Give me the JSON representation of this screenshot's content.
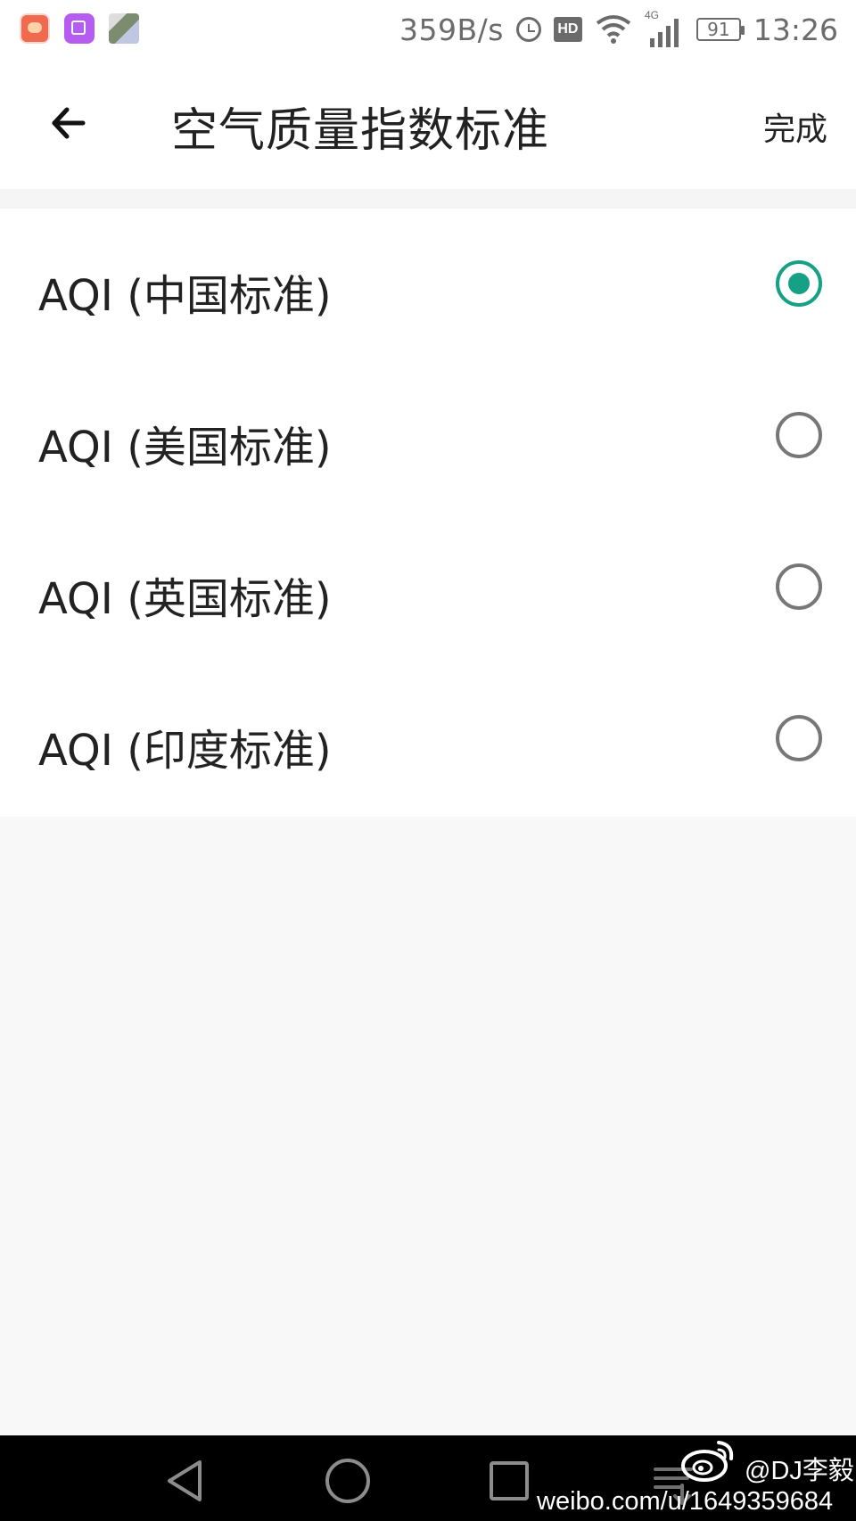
{
  "status_bar": {
    "net_speed": "359B/s",
    "hd_label": "HD",
    "network_label": "4G",
    "battery_level": "91",
    "time": "13:26",
    "icons": [
      "cow-app-icon",
      "gallery-icon",
      "collage-icon",
      "alarm-icon",
      "hd-icon",
      "wifi-icon",
      "cell-signal-icon",
      "battery-icon"
    ]
  },
  "header": {
    "title": "空气质量指数标准",
    "done_label": "完成",
    "back_icon": "arrow-left-icon"
  },
  "options": [
    {
      "label": "AQI (中国标准)",
      "selected": true
    },
    {
      "label": "AQI (美国标准)",
      "selected": false
    },
    {
      "label": "AQI (英国标准)",
      "selected": false
    },
    {
      "label": "AQI (印度标准)",
      "selected": false
    }
  ],
  "nav_bar": {
    "icons": [
      "nav-back-icon",
      "nav-home-icon",
      "nav-recents-icon",
      "nav-menu-icon"
    ]
  },
  "watermark": {
    "handle": "@DJ李毅",
    "url": "weibo.com/u/1649359684"
  },
  "colors": {
    "accent": "#16a085",
    "text": "#222222",
    "status_text": "#6b6b6b",
    "background": "#f8f8f8"
  }
}
